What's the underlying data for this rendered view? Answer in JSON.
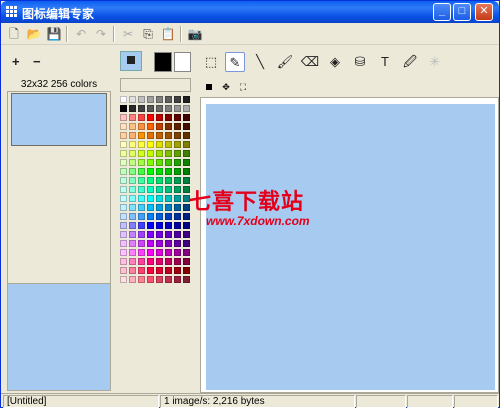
{
  "window": {
    "title": "图标编辑专家",
    "controls": {
      "minimize": "_",
      "maximize": "□",
      "close": "✕"
    }
  },
  "toolbar": {
    "items": [
      {
        "name": "new-file-icon",
        "glyph": "🗋",
        "enabled": true
      },
      {
        "name": "open-folder-icon",
        "glyph": "📂",
        "enabled": true
      },
      {
        "name": "save-icon",
        "glyph": "💾",
        "enabled": true
      },
      {
        "name": "undo-icon",
        "glyph": "↶",
        "enabled": false
      },
      {
        "name": "redo-icon",
        "glyph": "↷",
        "enabled": false
      },
      {
        "name": "cut-icon",
        "glyph": "✂",
        "enabled": false
      },
      {
        "name": "copy-icon",
        "glyph": "⎘",
        "enabled": true
      },
      {
        "name": "paste-icon",
        "glyph": "📋",
        "enabled": false
      },
      {
        "name": "camera-icon",
        "glyph": "📷",
        "enabled": true
      }
    ]
  },
  "left_panel": {
    "add_icon": "+",
    "remove_icon": "−",
    "format_label": "32x32 256 colors"
  },
  "colors": {
    "foreground": "#000000",
    "background": "#ffffff",
    "canvas": "#a6caf0"
  },
  "tools": {
    "items": [
      {
        "name": "select-rect-icon",
        "glyph": "⬚"
      },
      {
        "name": "pencil-icon",
        "glyph": "✎"
      },
      {
        "name": "line-icon",
        "glyph": "╲"
      },
      {
        "name": "brush-icon",
        "glyph": "🖌"
      },
      {
        "name": "eraser-icon",
        "glyph": "⌫"
      },
      {
        "name": "fill-icon",
        "glyph": "◈"
      },
      {
        "name": "shape-icon",
        "glyph": "⛁"
      },
      {
        "name": "text-icon",
        "glyph": "T"
      },
      {
        "name": "eyedropper-icon",
        "glyph": "🖉"
      },
      {
        "name": "sparkle-icon",
        "glyph": "✳"
      }
    ],
    "brush_sizes": [
      "■",
      "✥",
      "⛶"
    ]
  },
  "palette": [
    [
      "#ffffff",
      "#e0e0e0",
      "#c0c0c0",
      "#a0a0a0",
      "#808080",
      "#606060",
      "#404040",
      "#202020"
    ],
    [
      "#000000",
      "#2a2a2a",
      "#404040",
      "#555555",
      "#6a6a6a",
      "#7f7f7f",
      "#959595",
      "#aaaaaa"
    ],
    [
      "#ffc0c0",
      "#ff8080",
      "#ff4040",
      "#ff0000",
      "#c00000",
      "#800000",
      "#600000",
      "#400000"
    ],
    [
      "#ffe0c0",
      "#ffc080",
      "#ff9040",
      "#ff6000",
      "#c04000",
      "#803000",
      "#602000",
      "#401000"
    ],
    [
      "#ffd0a0",
      "#ffb070",
      "#ff9000",
      "#e07000",
      "#c06000",
      "#a05000",
      "#804000",
      "#603000"
    ],
    [
      "#ffffc0",
      "#ffff80",
      "#ffff40",
      "#ffff00",
      "#e0e000",
      "#c0c000",
      "#a0a000",
      "#808000"
    ],
    [
      "#f0ffa0",
      "#e0ff60",
      "#d0ff20",
      "#c0ff00",
      "#a0e000",
      "#80c000",
      "#60a000",
      "#408000"
    ],
    [
      "#e0ffc0",
      "#c0ff80",
      "#a0ff40",
      "#80ff00",
      "#60e000",
      "#40c000",
      "#20a000",
      "#108000"
    ],
    [
      "#c0ffc0",
      "#80ff80",
      "#40ff40",
      "#00ff00",
      "#00e000",
      "#00c000",
      "#00a000",
      "#008000"
    ],
    [
      "#c0ffe0",
      "#80ffc0",
      "#40ffa0",
      "#00ff80",
      "#00e070",
      "#00c060",
      "#00a050",
      "#008040"
    ],
    [
      "#c0fff0",
      "#80ffe0",
      "#40ffd0",
      "#00ffc0",
      "#00e0a0",
      "#00c080",
      "#00a060",
      "#008040"
    ],
    [
      "#c0ffff",
      "#80ffff",
      "#40ffff",
      "#00ffff",
      "#00e0e0",
      "#00c0c0",
      "#00a0a0",
      "#008080"
    ],
    [
      "#c0f0ff",
      "#80e0ff",
      "#40d0ff",
      "#00c0ff",
      "#00a0e0",
      "#0080c0",
      "#0060a0",
      "#004080"
    ],
    [
      "#c0e0ff",
      "#80c0ff",
      "#40a0ff",
      "#0080ff",
      "#0060e0",
      "#0040c0",
      "#0030a0",
      "#002080"
    ],
    [
      "#c0c0ff",
      "#8080ff",
      "#4040ff",
      "#0000ff",
      "#0000e0",
      "#0000c0",
      "#0000a0",
      "#000080"
    ],
    [
      "#e0c0ff",
      "#c080ff",
      "#a040ff",
      "#8000ff",
      "#7000e0",
      "#6000c0",
      "#5000a0",
      "#400080"
    ],
    [
      "#f0c0ff",
      "#e080ff",
      "#d040ff",
      "#c000ff",
      "#a000e0",
      "#8000c0",
      "#6000a0",
      "#400080"
    ],
    [
      "#ffc0ff",
      "#ff80ff",
      "#ff40ff",
      "#ff00ff",
      "#e000e0",
      "#c000c0",
      "#a000a0",
      "#800080"
    ],
    [
      "#ffc0e0",
      "#ff80c0",
      "#ff40a0",
      "#ff0080",
      "#e00070",
      "#c00060",
      "#a00050",
      "#800040"
    ],
    [
      "#ffc0d0",
      "#ff80a0",
      "#ff4070",
      "#ff0040",
      "#e00030",
      "#c00020",
      "#a00010",
      "#800000"
    ],
    [
      "#ffe0e0",
      "#ffb0c0",
      "#ff8090",
      "#ff5070",
      "#e04060",
      "#c03050",
      "#a02040",
      "#802030"
    ]
  ],
  "watermark": {
    "text": "七喜下载站",
    "url": "www.7xdown.com"
  },
  "statusbar": {
    "file": "[Untitled]",
    "info": "1 image/s: 2,216 bytes",
    "cell3": "",
    "cell4": "",
    "cell5": ""
  }
}
